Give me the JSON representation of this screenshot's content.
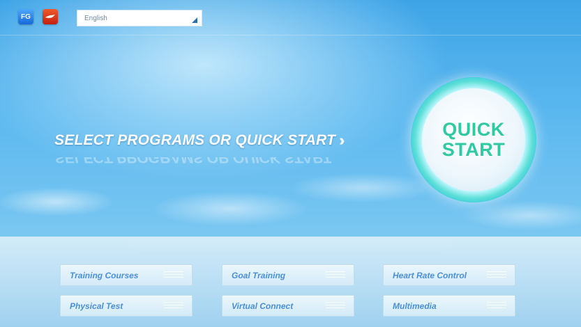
{
  "topbar": {
    "icons": [
      {
        "name": "fg-app-icon",
        "text": "FG"
      },
      {
        "name": "red-app-icon",
        "text": ""
      }
    ],
    "language": {
      "selected": "English"
    }
  },
  "hero": {
    "headline": "SELECT PROGRAMS OR QUICK START",
    "chevrons": "›››››",
    "quick_start": {
      "line1": "QUICK",
      "line2": "START"
    }
  },
  "menu": {
    "buttons": [
      {
        "label": "Training Courses"
      },
      {
        "label": "Goal Training"
      },
      {
        "label": "Heart Rate Control"
      },
      {
        "label": "Physical Test"
      },
      {
        "label": "Virtual Connect"
      },
      {
        "label": "Multimedia"
      }
    ]
  },
  "colors": {
    "accent": "#2fc9a2",
    "button_text": "#4a8fd9",
    "sky": "#3ea4e6"
  }
}
